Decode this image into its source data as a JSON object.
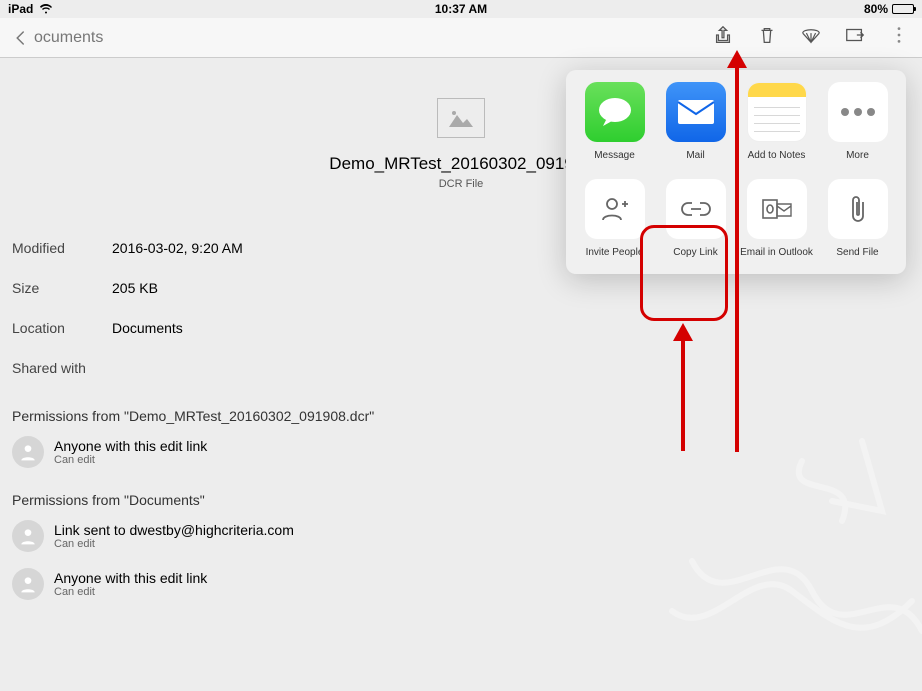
{
  "status_bar": {
    "device": "iPad",
    "time": "10:37 AM",
    "battery_pct": "80%"
  },
  "nav": {
    "back_label": "ocuments"
  },
  "file": {
    "name": "Demo_MRTest_20160302_091908",
    "type": "DCR File"
  },
  "meta": {
    "modified_label": "Modified",
    "modified_value": "2016-03-02, 9:20 AM",
    "size_label": "Size",
    "size_value": "205 KB",
    "location_label": "Location",
    "location_value": "Documents",
    "shared_with_label": "Shared with"
  },
  "permissions_file": {
    "header": "Permissions from \"Demo_MRTest_20160302_091908.dcr\"",
    "items": [
      {
        "title": "Anyone with this edit link",
        "sub": "Can edit"
      }
    ]
  },
  "permissions_folder": {
    "header": "Permissions from \"Documents\"",
    "items": [
      {
        "title": "Link sent to dwestby@highcriteria.com",
        "sub": "Can edit"
      },
      {
        "title": "Anyone with this edit link",
        "sub": "Can edit"
      }
    ]
  },
  "share_sheet": {
    "row1": [
      {
        "label": "Message",
        "style": "green"
      },
      {
        "label": "Mail",
        "style": "blue"
      },
      {
        "label": "Add to Notes",
        "style": "notes"
      },
      {
        "label": "More",
        "style": "more"
      }
    ],
    "row2": [
      {
        "label": "Invite People"
      },
      {
        "label": "Copy Link"
      },
      {
        "label": "Email in Outlook"
      },
      {
        "label": "Send File"
      }
    ]
  },
  "annotation_colors": {
    "highlight": "#d40000"
  }
}
